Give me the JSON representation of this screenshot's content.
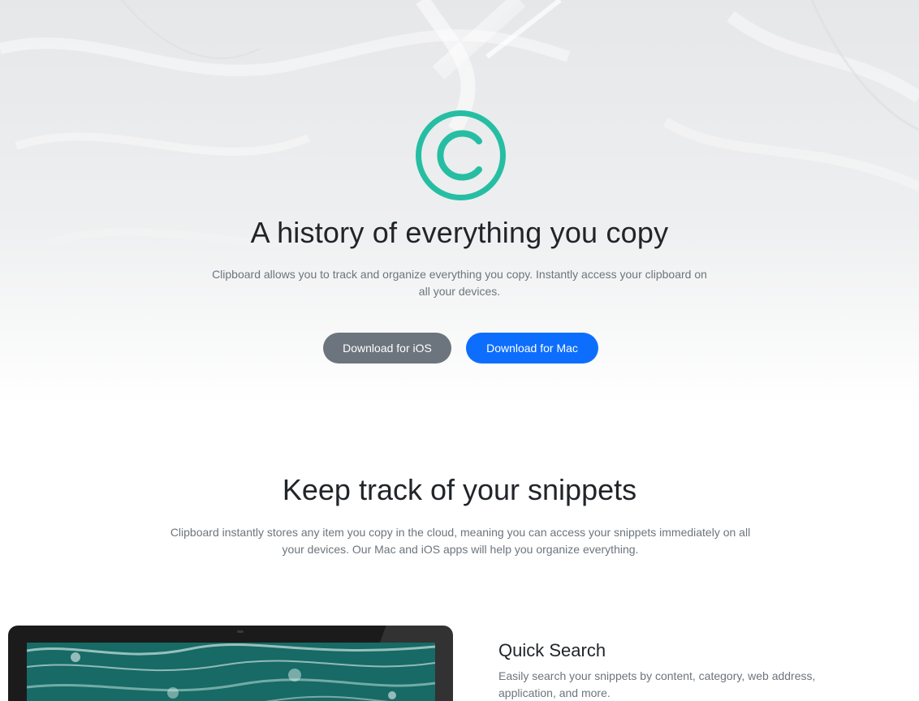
{
  "hero": {
    "title": "A history of everything you copy",
    "subtitle": "Clipboard allows you to track and organize everything you copy. Instantly access your clipboard on all your devices.",
    "logo_icon": "copyright-icon",
    "buttons": {
      "ios": "Download for iOS",
      "mac": "Download for Mac"
    }
  },
  "section": {
    "title": "Keep track of your snippets",
    "subtitle": "Clipboard instantly stores any item you copy in the cloud, meaning you can access your snippets immediately on all your devices. Our Mac and iOS apps will help you organize everything."
  },
  "feature": {
    "title": "Quick Search",
    "text": "Easily search your snippets by content, category, web address, application, and more."
  },
  "colors": {
    "accent": "#26bea3",
    "ios_button": "#6c757d",
    "mac_button": "#0d6efd",
    "text_dark": "#212529",
    "text_muted": "#6c757d"
  }
}
